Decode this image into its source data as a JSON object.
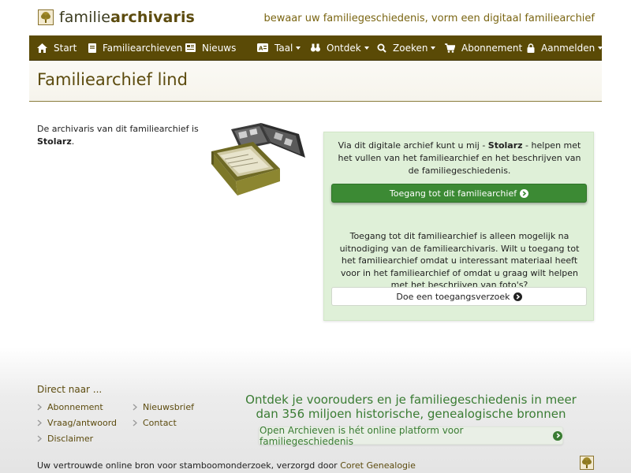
{
  "brand": {
    "name_light": "familie",
    "name_bold": "archivaris",
    "logo_icon": "tree-icon"
  },
  "tagline": "bewaar uw familiegeschiedenis, vorm een digitaal familiearchief",
  "nav": {
    "start": "Start",
    "familiearchieven": "Familiearchieven",
    "nieuws": "Nieuws",
    "taal": "Taal",
    "ontdek": "Ontdek",
    "zoeken": "Zoeken",
    "abonnement": "Abonnement",
    "aanmelden": "Aanmelden"
  },
  "page": {
    "title": "Familiearchief lind"
  },
  "intro": {
    "text": "De archivaris van dit familiearchief is ",
    "name": "Stolarz",
    "end": "."
  },
  "panel": {
    "text1_a": "Via dit digitale archief kunt u mij - ",
    "text1_name": "Stolarz",
    "text1_b": " - helpen met het vullen van het familiearchief en het beschrijven van de familiegeschiedenis.",
    "access_button": "Toegang tot dit familiearchief",
    "text2": "Toegang tot dit familiearchief is alleen mogelijk na uitnodiging van de familiearchivaris. Wilt u toegang tot het familiearchief omdat u interessant materiaal heeft voor in het familiearchief of omdat u graag wilt helpen met het beschrijven van foto's?",
    "request_button": "Doe een toegangsverzoek"
  },
  "footer": {
    "heading": "Direct naar ...",
    "links": {
      "abonnement": "Abonnement",
      "nieuwsbrief": "Nieuwsbrief",
      "vraag": "Vraag/antwoord",
      "contact": "Contact",
      "disclaimer": "Disclaimer"
    },
    "promo": "Ontdek je voorouders en je familiegeschiedenis in meer dan 356 miljoen historische, genealogische bronnen",
    "promo_button": "Open Archieven is hét online platform voor familiegeschiedenis",
    "bottom_text": "Uw vertrouwde online bron voor stamboomonderzoek, verzorgd door ",
    "bottom_link": "Coret Genealogie"
  },
  "colors": {
    "nav_bg": "#5a4a06",
    "brand_text": "#5c4b0e",
    "green_button": "#3c8a34",
    "panel_bg": "#dff0d8",
    "promo_green": "#3a7c33"
  }
}
